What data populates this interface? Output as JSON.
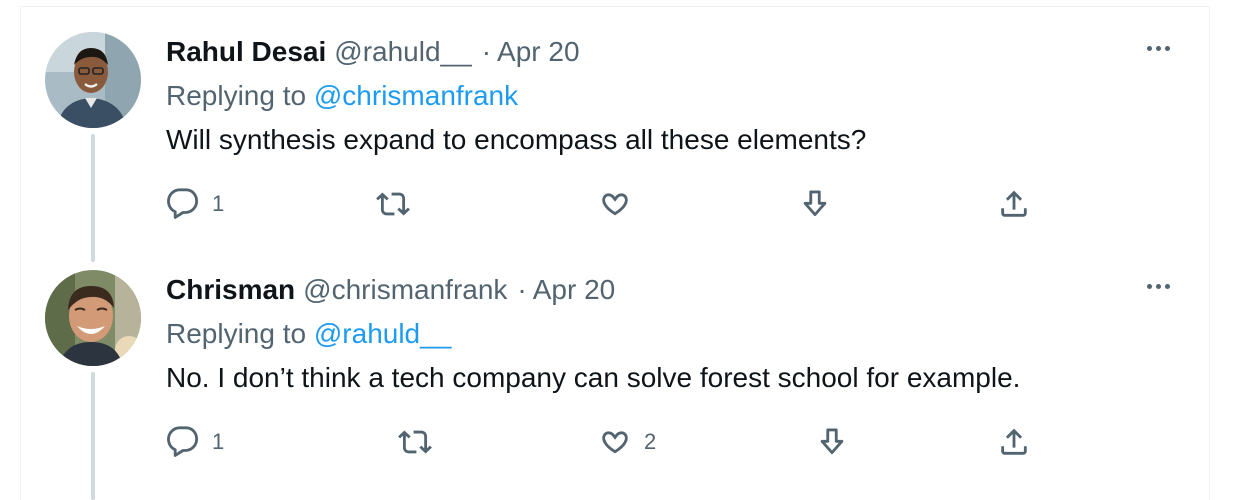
{
  "tweets": [
    {
      "name": "Rahul Desai",
      "handle": "@rahuld__",
      "separator": "·",
      "date": "Apr 20",
      "replying_prefix": "Replying to",
      "replying_to": "@chrismanfrank",
      "text": "Will synthesis expand to encompass all these elements?",
      "reply_count": "1",
      "retweet_count": "",
      "like_count": "",
      "avatar_color": "#9fb4bf"
    },
    {
      "name": "Chrisman",
      "handle": "@chrismanfrank",
      "separator": "·",
      "date": "Apr 20",
      "replying_prefix": "Replying to",
      "replying_to": "@rahuld__",
      "text": "No. I don’t think a tech company can solve forest school for example.",
      "reply_count": "1",
      "retweet_count": "",
      "like_count": "2",
      "avatar_color": "#6b7a55"
    }
  ],
  "icons": {
    "reply": "reply-icon",
    "retweet": "retweet-icon",
    "like": "heart-icon",
    "downvote": "arrow-down-icon",
    "share": "share-icon",
    "more": "more-icon"
  },
  "colors": {
    "text": "#0f1419",
    "muted": "#536471",
    "link": "#1d9bf0",
    "thread_line": "#cfd9de"
  }
}
